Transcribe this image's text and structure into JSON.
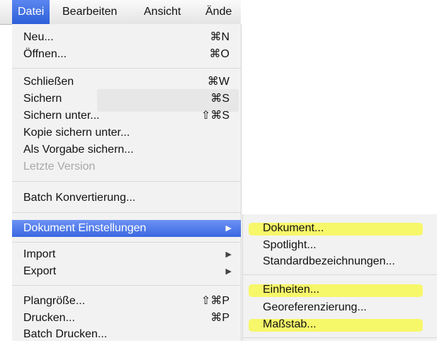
{
  "menubar": {
    "items": [
      {
        "label": "Datei"
      },
      {
        "label": "Bearbeiten"
      },
      {
        "label": "Ansicht"
      },
      {
        "label": "Ände"
      }
    ]
  },
  "file_menu": {
    "items": [
      {
        "label": "Neu...",
        "shortcut": "⌘N"
      },
      {
        "label": "Öffnen...",
        "shortcut": "⌘O"
      },
      {
        "label": "Schließen",
        "shortcut": "⌘W"
      },
      {
        "label": "Sichern",
        "shortcut": "⌘S"
      },
      {
        "label": "Sichern unter...",
        "shortcut": "⇧⌘S"
      },
      {
        "label": "Kopie sichern unter..."
      },
      {
        "label": "Als Vorgabe sichern..."
      },
      {
        "label": "Letzte Version",
        "disabled": true
      },
      {
        "label": "Batch Konvertierung..."
      },
      {
        "label": "Dokument Einstellungen",
        "arrow": "▶",
        "highlighted": true
      },
      {
        "label": "Import",
        "arrow": "▶"
      },
      {
        "label": "Export",
        "arrow": "▶"
      },
      {
        "label": "Plangröße...",
        "shortcut": "⇧⌘P"
      },
      {
        "label": "Drucken...",
        "shortcut": "⌘P"
      },
      {
        "label": "Batch Drucken..."
      }
    ]
  },
  "submenu": {
    "items": [
      {
        "label": "Dokument...",
        "marked": true
      },
      {
        "label": "Spotlight..."
      },
      {
        "label": "Standardbezeichnungen..."
      },
      {
        "label": "Einheiten...",
        "marked": true
      },
      {
        "label": "Georeferenzierung..."
      },
      {
        "label": "Maßstab...",
        "marked": true
      }
    ]
  },
  "colors": {
    "menu_highlight": "#3a68e0",
    "marker_yellow": "#f7f76a",
    "menu_background": "#f2f2f2"
  }
}
